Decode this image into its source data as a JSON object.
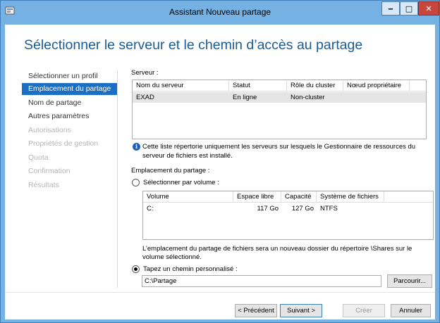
{
  "window": {
    "title": "Assistant Nouveau partage",
    "controls": {
      "minimize": "‒",
      "maximize": "□",
      "close": "✕"
    }
  },
  "page": {
    "heading": "Sélectionner le serveur et le chemin d’accès au partage"
  },
  "nav": {
    "items": [
      {
        "label": "Sélectionner un profil",
        "state": "normal"
      },
      {
        "label": "Emplacement du partage",
        "state": "active"
      },
      {
        "label": "Nom de partage",
        "state": "normal"
      },
      {
        "label": "Autres paramètres",
        "state": "normal"
      },
      {
        "label": "Autorisations",
        "state": "disabled"
      },
      {
        "label": "Propriétés de gestion",
        "state": "disabled"
      },
      {
        "label": "Quota",
        "state": "disabled"
      },
      {
        "label": "Confirmation",
        "state": "disabled"
      },
      {
        "label": "Résultats",
        "state": "disabled"
      }
    ]
  },
  "server": {
    "label": "Serveur :",
    "columns": [
      "Nom du serveur",
      "Statut",
      "Rôle du cluster",
      "Nœud propriétaire"
    ],
    "rows": [
      [
        "EXAD",
        "En ligne",
        "Non-cluster",
        ""
      ]
    ],
    "info_line1": "Cette liste répertorie uniquement les serveurs sur lesquels le Gestionnaire de ressources du",
    "info_line2": "serveur de fichiers est installé."
  },
  "location": {
    "label": "Emplacement du partage :",
    "by_volume_label": "Sélectionner par volume :",
    "by_volume_selected": false,
    "volume_columns": [
      "Volume",
      "Espace libre",
      "Capacité",
      "Système de fichiers"
    ],
    "volume_rows": [
      [
        "C:",
        "117 Go",
        "127 Go",
        "NTFS"
      ]
    ],
    "note_line1": "L’emplacement du partage de fichiers sera un nouveau dossier du répertoire \\Shares sur le",
    "note_line2": "volume sélectionné.",
    "custom_path_label": "Tapez un chemin personnalisé :",
    "custom_path_selected": true,
    "custom_path_value": "C:\\Partage",
    "browse_label": "Parcourir..."
  },
  "footer": {
    "previous_label": "< Précédent",
    "next_label": "Suivant >",
    "create_label": "Créer",
    "cancel_label": "Annuler"
  },
  "colors": {
    "frame": "#75b1e3",
    "heading": "#1c5b93",
    "nav_active_bg": "#1a6fc3",
    "selected_row": "#e5e5e5",
    "info_icon": "#1f5fb5"
  }
}
